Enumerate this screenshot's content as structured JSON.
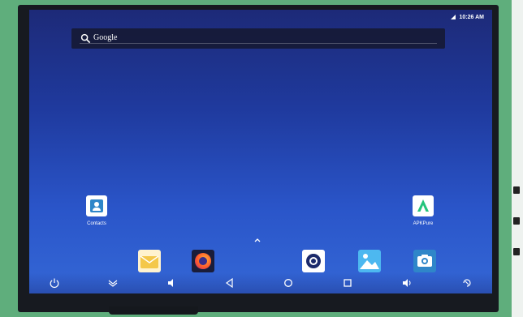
{
  "status_bar": {
    "time": "10:26 AM"
  },
  "search": {
    "label": "Google"
  },
  "apps": {
    "contacts": {
      "label": "Contacts"
    },
    "apkpure": {
      "label": "APKPure"
    }
  },
  "icons": {
    "dock": [
      "email-icon",
      "firefox-icon",
      "camera-lens-icon",
      "gallery-icon",
      "camera-icon"
    ],
    "nav": [
      "power-icon",
      "collapse-icon",
      "volume-down-icon",
      "back-icon",
      "home-icon",
      "recents-icon",
      "volume-up-icon",
      "screen-rotate-icon"
    ]
  },
  "colors": {
    "wallpaper_top": "#1d2a78",
    "wallpaper_bottom": "#3467d6",
    "pcb_green": "#5fae7c",
    "apkpure_green": "#24c47b",
    "contacts_blue": "#2f86c9"
  }
}
